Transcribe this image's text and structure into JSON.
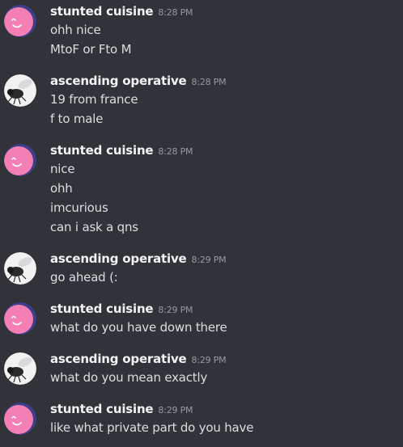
{
  "users": {
    "stunted": "stunted cuisine",
    "ascending": "ascending operative"
  },
  "messages": [
    {
      "user": "stunted cuisine",
      "time": "8:28 PM",
      "lines": [
        "ohh nice",
        "MtoF or Fto M"
      ]
    },
    {
      "user": "ascending operative",
      "time": "8:28 PM",
      "lines": [
        "19 from france",
        "f to male"
      ]
    },
    {
      "user": "stunted cuisine",
      "time": "8:28 PM",
      "lines": [
        "nice",
        "ohh",
        "imcurious",
        "can i ask a qns"
      ]
    },
    {
      "user": "ascending operative",
      "time": "8:29 PM",
      "lines": [
        "go ahead (:"
      ]
    },
    {
      "user": "stunted cuisine",
      "time": "8:29 PM",
      "lines": [
        "what do you have down there"
      ]
    },
    {
      "user": "ascending operative",
      "time": "8:29 PM",
      "lines": [
        "what do you mean exactly"
      ]
    },
    {
      "user": "stunted cuisine",
      "time": "8:29 PM",
      "lines": [
        "like what private part do you have"
      ]
    }
  ],
  "icons": {
    "stunted_avatar": "pink-smiley-avatar-icon",
    "ascending_avatar": "fly-avatar-icon"
  },
  "colors": {
    "background": "#313338",
    "username": "#f2f3f5",
    "message_text": "#dbdee1",
    "timestamp": "#949ba4",
    "pink_avatar": "#f47fb4",
    "pink_avatar_ring": "#5865f2"
  }
}
